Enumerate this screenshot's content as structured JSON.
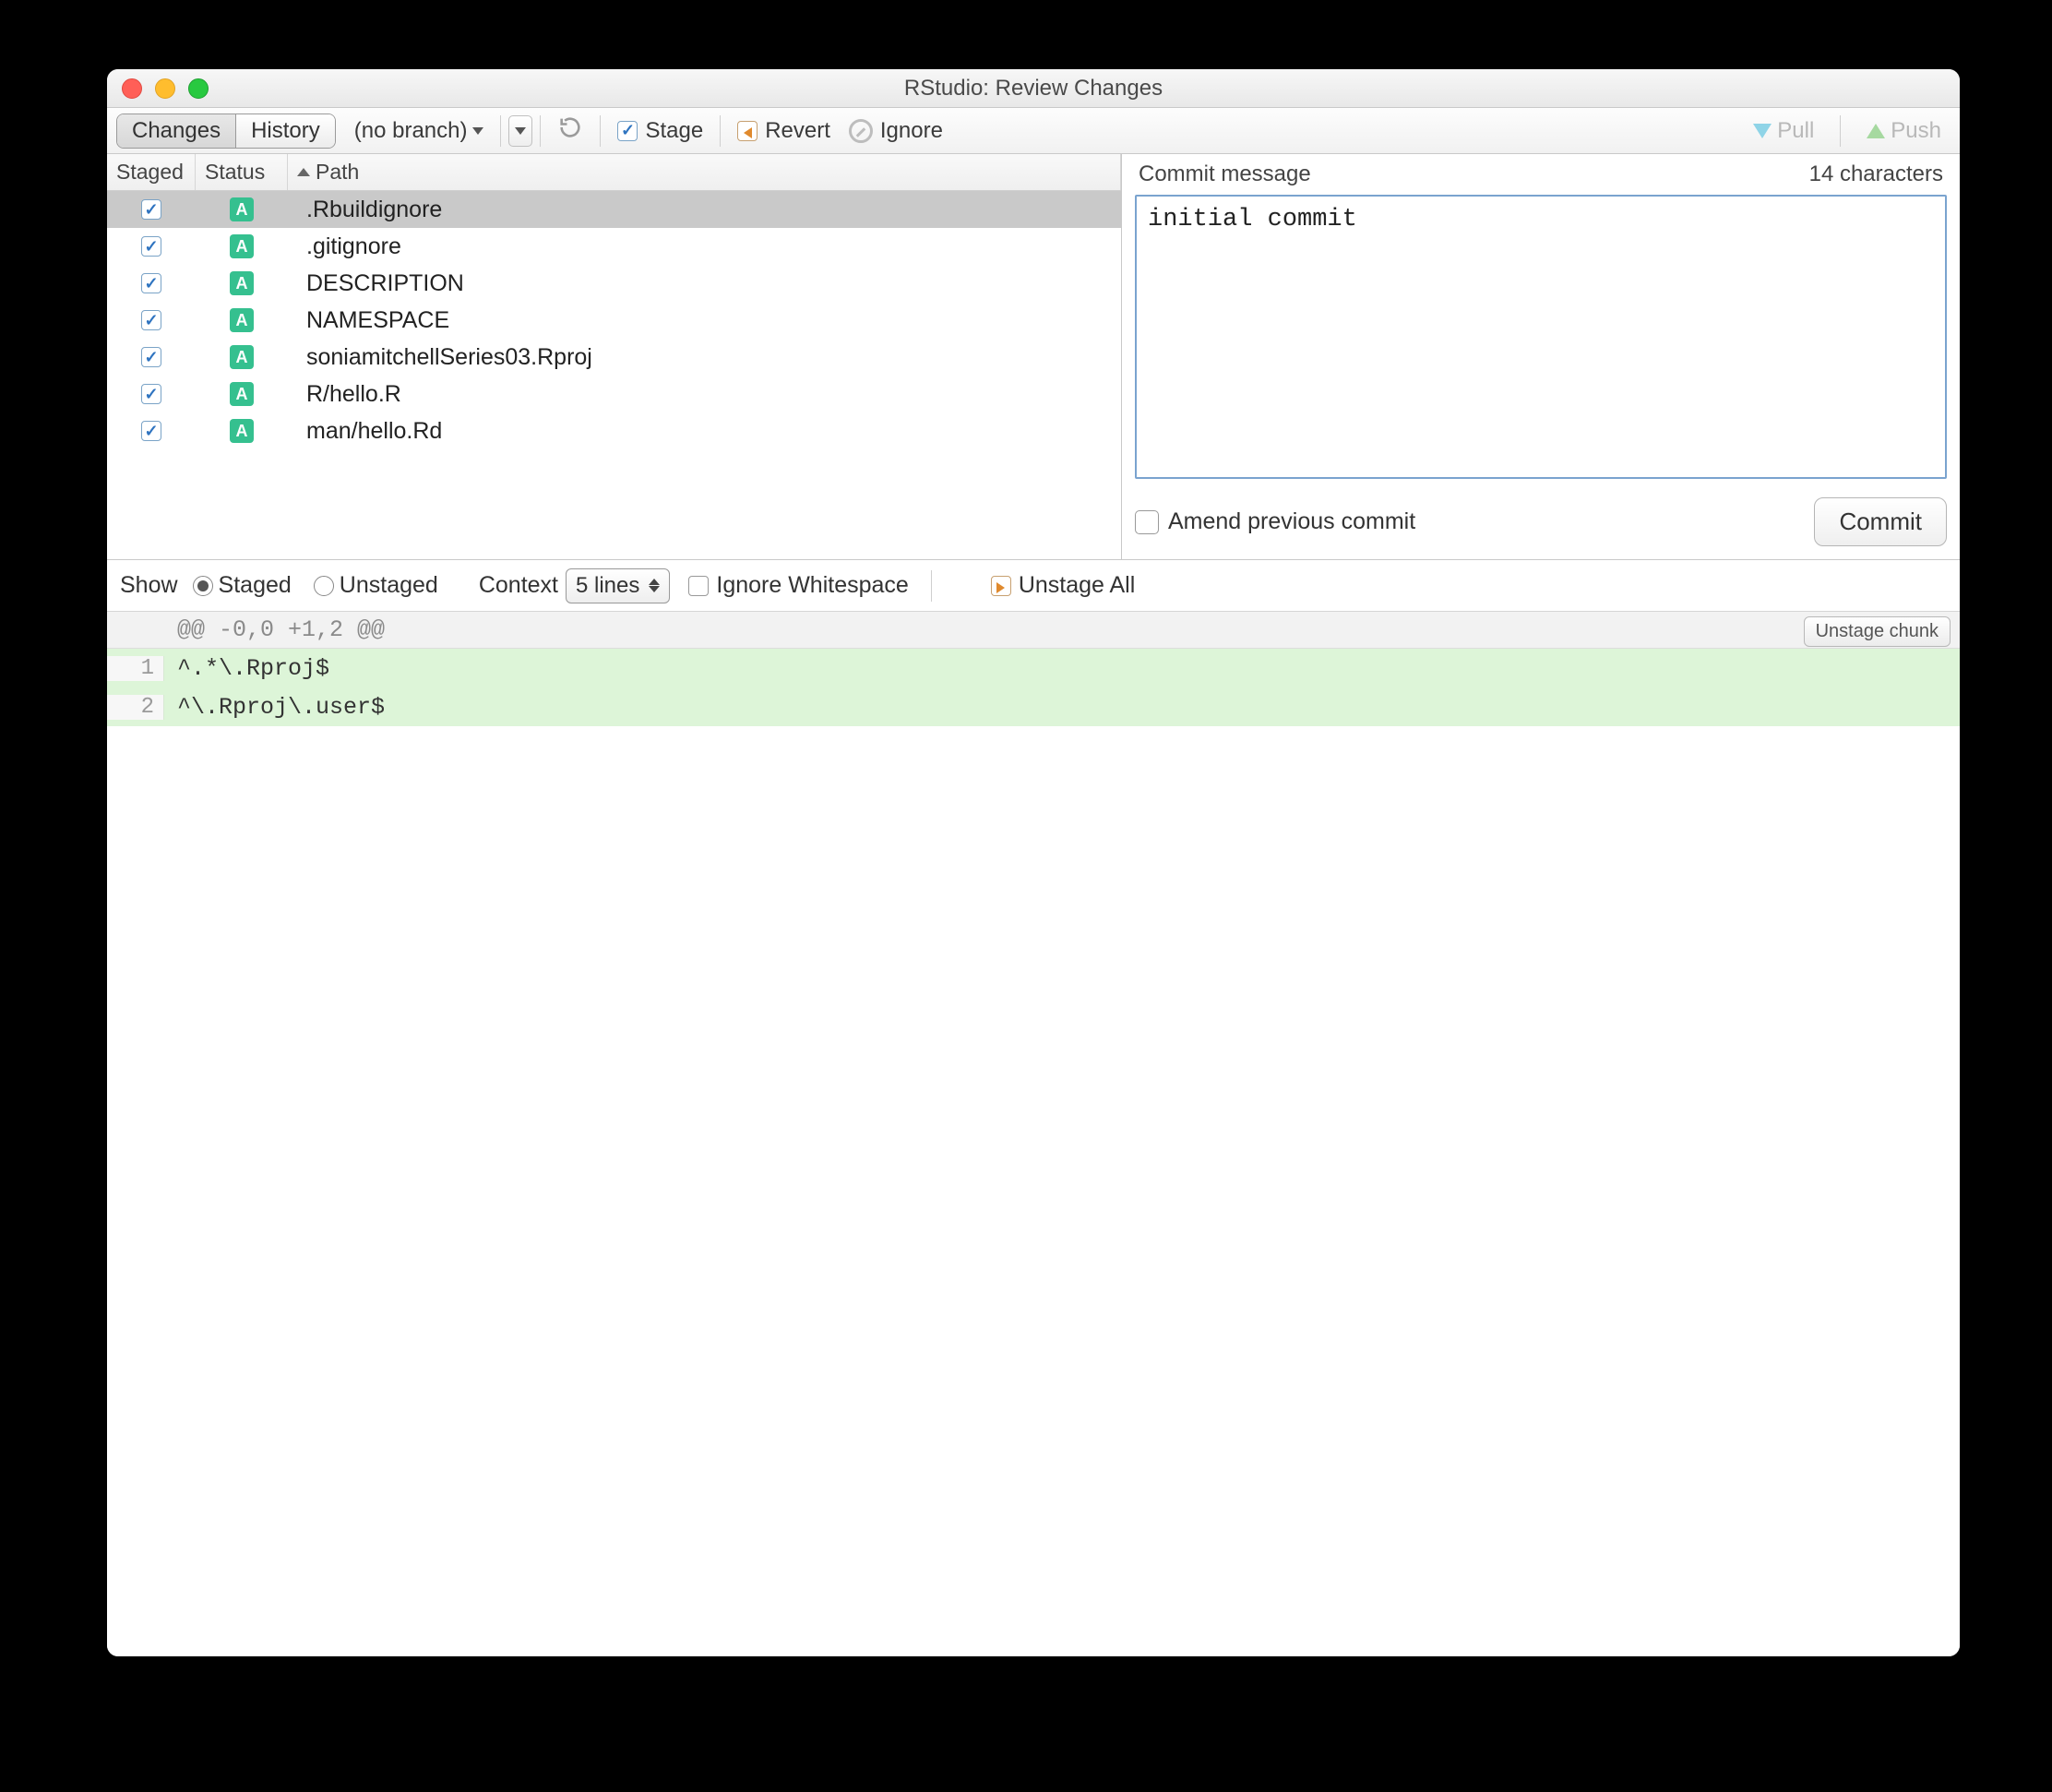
{
  "window": {
    "title": "RStudio: Review Changes"
  },
  "toolbar": {
    "tabs": {
      "changes": "Changes",
      "history": "History"
    },
    "branch": "(no branch)",
    "stage": "Stage",
    "revert": "Revert",
    "ignore": "Ignore",
    "pull": "Pull",
    "push": "Push"
  },
  "files": {
    "headers": {
      "staged": "Staged",
      "status": "Status",
      "path": "Path"
    },
    "rows": [
      {
        "staged": true,
        "status": "A",
        "path": ".Rbuildignore",
        "selected": true
      },
      {
        "staged": true,
        "status": "A",
        "path": ".gitignore",
        "selected": false
      },
      {
        "staged": true,
        "status": "A",
        "path": "DESCRIPTION",
        "selected": false
      },
      {
        "staged": true,
        "status": "A",
        "path": "NAMESPACE",
        "selected": false
      },
      {
        "staged": true,
        "status": "A",
        "path": "soniamitchellSeries03.Rproj",
        "selected": false
      },
      {
        "staged": true,
        "status": "A",
        "path": "R/hello.R",
        "selected": false
      },
      {
        "staged": true,
        "status": "A",
        "path": "man/hello.Rd",
        "selected": false
      }
    ]
  },
  "commit": {
    "label": "Commit message",
    "char_count": "14 characters",
    "message": "initial commit",
    "amend": "Amend previous commit",
    "button": "Commit"
  },
  "diffbar": {
    "show": "Show",
    "staged": "Staged",
    "unstaged": "Unstaged",
    "context": "Context",
    "context_value": "5 lines",
    "ignore_ws": "Ignore Whitespace",
    "unstage_all": "Unstage All"
  },
  "diff": {
    "hunk": "@@ -0,0 +1,2 @@",
    "unstage_chunk": "Unstage chunk",
    "lines": [
      {
        "n": "1",
        "text": "^.*\\.Rproj$"
      },
      {
        "n": "2",
        "text": "^\\.Rproj\\.user$"
      }
    ]
  }
}
